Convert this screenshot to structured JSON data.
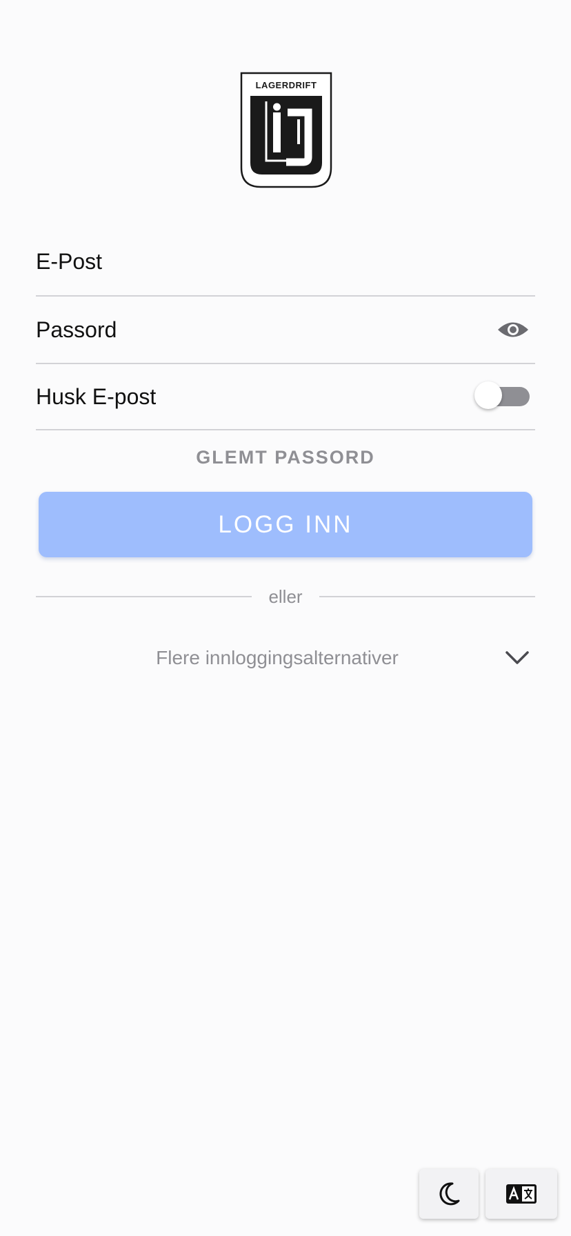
{
  "logo": {
    "text": "LAGERDRIFT",
    "icon": "lagerdrift-logo"
  },
  "form": {
    "email_label": "E-Post",
    "password_label": "Passord",
    "remember_label": "Husk E-post",
    "remember_checked": false,
    "forgot_label": "GLEMT PASSORD",
    "login_label": "LOGG INN"
  },
  "divider": {
    "text": "eller"
  },
  "more_options": {
    "label": "Flere innloggingsalternativer",
    "icon": "chevron-down-icon"
  },
  "fabs": {
    "dark_mode_icon": "moon-icon",
    "language_icon": "translate-icon"
  },
  "colors": {
    "accent_disabled": "#9ebdfd",
    "muted_text": "#8f8f94",
    "divider": "#d2d2d6"
  }
}
